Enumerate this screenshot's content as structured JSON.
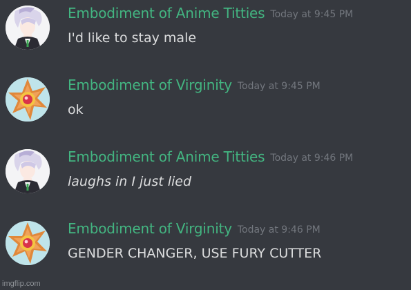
{
  "messages": [
    {
      "username": "Embodiment of Anime Titties",
      "timestamp": "Today at 9:45 PM",
      "text": "I'd like to stay male",
      "italic": false,
      "avatar": "anime-character-avatar"
    },
    {
      "username": "Embodiment of Virginity",
      "timestamp": "Today at 9:45 PM",
      "text": "ok",
      "italic": false,
      "avatar": "starmie-avatar"
    },
    {
      "username": "Embodiment of Anime Titties",
      "timestamp": "Today at 9:46 PM",
      "text": "laughs in I just lied",
      "italic": true,
      "avatar": "anime-character-avatar"
    },
    {
      "username": "Embodiment of Virginity",
      "timestamp": "Today at 9:46 PM",
      "text": "GENDER CHANGER, USE FURY CUTTER",
      "italic": false,
      "avatar": "starmie-avatar"
    }
  ],
  "watermark": "imgflip.com",
  "colors": {
    "background": "#36393f",
    "username": "#43b581",
    "timestamp": "#72767d",
    "text": "#dcddde"
  }
}
